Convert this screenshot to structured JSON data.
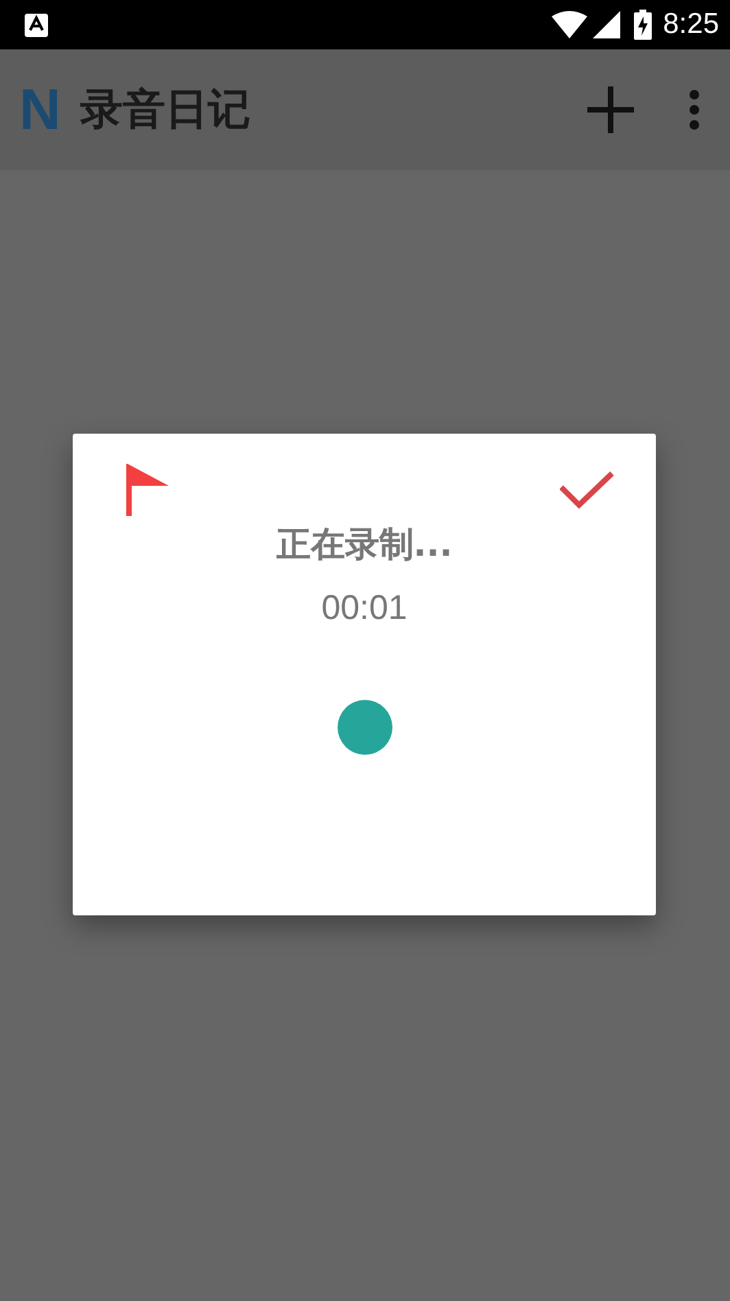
{
  "status_bar": {
    "time": "8:25"
  },
  "app_bar": {
    "logo": "N",
    "title": "录音日记"
  },
  "dialog": {
    "title": "正在录制...",
    "timer": "00:01"
  }
}
